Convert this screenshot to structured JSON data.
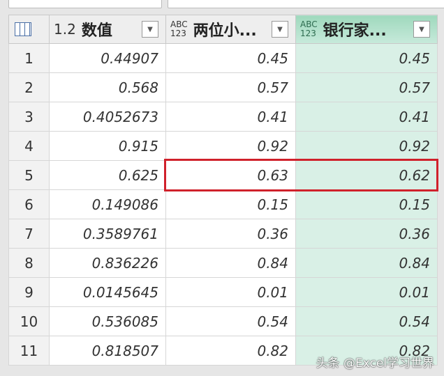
{
  "header": {
    "columns": [
      {
        "type_label": "1.2",
        "name": "数值"
      },
      {
        "type_label_top": "ABC",
        "type_label_bottom": "123",
        "name": "两位小..."
      },
      {
        "type_label_top": "ABC",
        "type_label_bottom": "123",
        "name": "银行家..."
      }
    ]
  },
  "rows": [
    {
      "n": "1",
      "a": "0.44907",
      "b": "0.45",
      "c": "0.45"
    },
    {
      "n": "2",
      "a": "0.568",
      "b": "0.57",
      "c": "0.57"
    },
    {
      "n": "3",
      "a": "0.4052673",
      "b": "0.41",
      "c": "0.41"
    },
    {
      "n": "4",
      "a": "0.915",
      "b": "0.92",
      "c": "0.92"
    },
    {
      "n": "5",
      "a": "0.625",
      "b": "0.63",
      "c": "0.62"
    },
    {
      "n": "6",
      "a": "0.149086",
      "b": "0.15",
      "c": "0.15"
    },
    {
      "n": "7",
      "a": "0.3589761",
      "b": "0.36",
      "c": "0.36"
    },
    {
      "n": "8",
      "a": "0.836226",
      "b": "0.84",
      "c": "0.84"
    },
    {
      "n": "9",
      "a": "0.0145645",
      "b": "0.01",
      "c": "0.01"
    },
    {
      "n": "10",
      "a": "0.536085",
      "b": "0.54",
      "c": "0.54"
    },
    {
      "n": "11",
      "a": "0.818507",
      "b": "0.82",
      "c": "0.82"
    }
  ],
  "highlight_color": "#d0212b",
  "watermark": "头条 @Excel学习世界"
}
